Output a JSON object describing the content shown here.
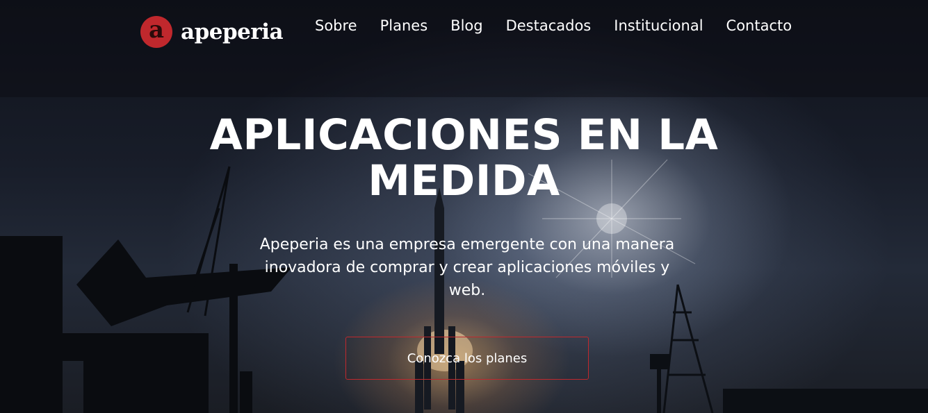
{
  "brand": {
    "name": "apeperia",
    "mark": "a",
    "accent_color": "#c0282d"
  },
  "nav": {
    "items": [
      {
        "label": "Sobre"
      },
      {
        "label": "Planes"
      },
      {
        "label": "Blog"
      },
      {
        "label": "Destacados"
      },
      {
        "label": "Institucional"
      },
      {
        "label": "Contacto"
      }
    ]
  },
  "hero": {
    "headline_line1": "APLICACIONES EN LA",
    "headline_line2": "MEDIDA",
    "subtitle": "Apeperia es una empresa emergente con una manera inovadora de comprar y crear aplicaciones móviles y web.",
    "cta_label": "Conozca los planes",
    "background": "rocket-launch-photo"
  }
}
